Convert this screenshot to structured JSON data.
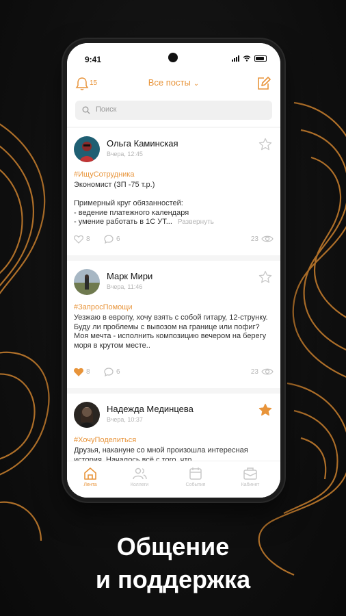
{
  "status_bar": {
    "time": "9:41"
  },
  "header": {
    "notifications_count": "15",
    "feed_title": "Все посты"
  },
  "search": {
    "placeholder": "Поиск"
  },
  "posts": [
    {
      "author": "Ольга Каминская",
      "date": "Вчера, 12:45",
      "tag": "#ИщуСотрудника",
      "text": "Экономист (ЗП -75 т.р.)\n\nПримерный круг обязанностей:\n- ведение платежного календаря\n- умение работать в 1С УТ...",
      "expand_label": "Развернуть",
      "likes": "8",
      "comments": "6",
      "views": "23",
      "liked": false,
      "starred": false
    },
    {
      "author": "Марк Мири",
      "date": "Вчера, 11:46",
      "tag": "#ЗапросПомощи",
      "text": "Уезжаю в европу, хочу взять с собой гитару, 12-струнку. Буду ли проблемы с вывозом на границе или пофиг?\nМоя мечта - исполнить композицию вечером на берегу моря в крутом месте..",
      "likes": "8",
      "comments": "6",
      "views": "23",
      "liked": true,
      "starred": false
    },
    {
      "author": "Надежда Мединцева",
      "date": "Вчера, 10:37",
      "tag": "#ХочуПоделиться",
      "text": "Друзья, накануне со мной произошла интересная история. Началось всё с того, что",
      "liked": false,
      "starred": true
    }
  ],
  "tabbar": {
    "items": [
      {
        "label": "Лента",
        "icon": "home-icon",
        "active": true
      },
      {
        "label": "Коллеги",
        "icon": "users-icon",
        "active": false
      },
      {
        "label": "События",
        "icon": "calendar-icon",
        "active": false
      },
      {
        "label": "Кабинет",
        "icon": "mailbox-icon",
        "active": false
      }
    ]
  },
  "promo": {
    "line1": "Общение",
    "line2": "и поддержка"
  },
  "colors": {
    "accent": "#e8943a",
    "background": "#0e0e0e",
    "text": "#111111"
  }
}
